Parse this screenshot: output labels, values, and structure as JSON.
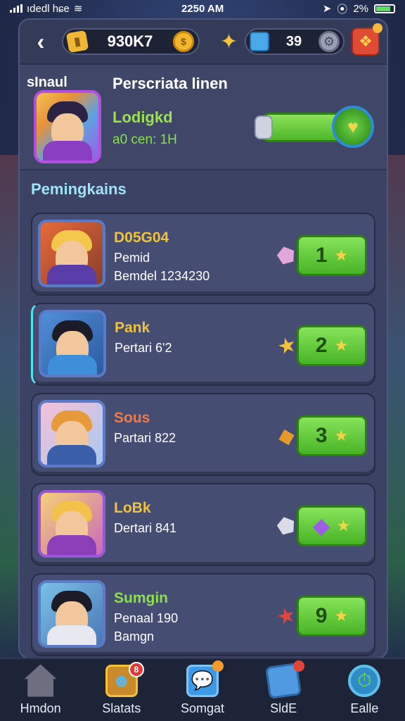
{
  "status_bar": {
    "carrier": "ıdedl hɕe",
    "time": "2250 AM",
    "battery": "2%"
  },
  "topbar": {
    "back_icon": "chevron-left-icon",
    "coins": "930K7",
    "gems": "39"
  },
  "featured": {
    "label": "sInaul",
    "title": "Perscriata linen",
    "name": "Lodigkd",
    "subtitle": "a0 cen: 1H"
  },
  "section_title": "Pemingkains",
  "rows": [
    {
      "name": "D05G04",
      "name_color": "#f1c23b",
      "line1": "Pemid",
      "line2": "Bemdel 1234230",
      "rank": "1",
      "item_icon": "gem-shard-icon"
    },
    {
      "name": "Pank",
      "name_color": "#f1c23b",
      "line1": "Pertari 6'2",
      "line2": "",
      "rank": "2",
      "item_icon": "gold-star-icon"
    },
    {
      "name": "Sous",
      "name_color": "#f07a4a",
      "line1": "Partari 822",
      "line2": "",
      "rank": "3",
      "item_icon": "golden-blade-icon"
    },
    {
      "name": "LoBk",
      "name_color": "#f1c23b",
      "line1": "Dertari 841",
      "line2": "",
      "rank": "",
      "item_icon": "purple-crystal-icon"
    },
    {
      "name": "Sumgin",
      "name_color": "#8de04e",
      "line1": "Penaal 190",
      "line2": "Bamgn",
      "rank": "9",
      "item_icon": "red-star-icon"
    }
  ],
  "bottom_nav": [
    {
      "label": "Hmdon",
      "icon": "home-icon",
      "badge": ""
    },
    {
      "label": "Slatats",
      "icon": "stats-card-icon",
      "badge": "8"
    },
    {
      "label": "Somgat",
      "icon": "chat-bubble-icon",
      "badge": ""
    },
    {
      "label": "SldE",
      "icon": "shop-box-icon",
      "badge": ""
    },
    {
      "label": "Ealle",
      "icon": "battle-gear-icon",
      "badge": ""
    }
  ]
}
